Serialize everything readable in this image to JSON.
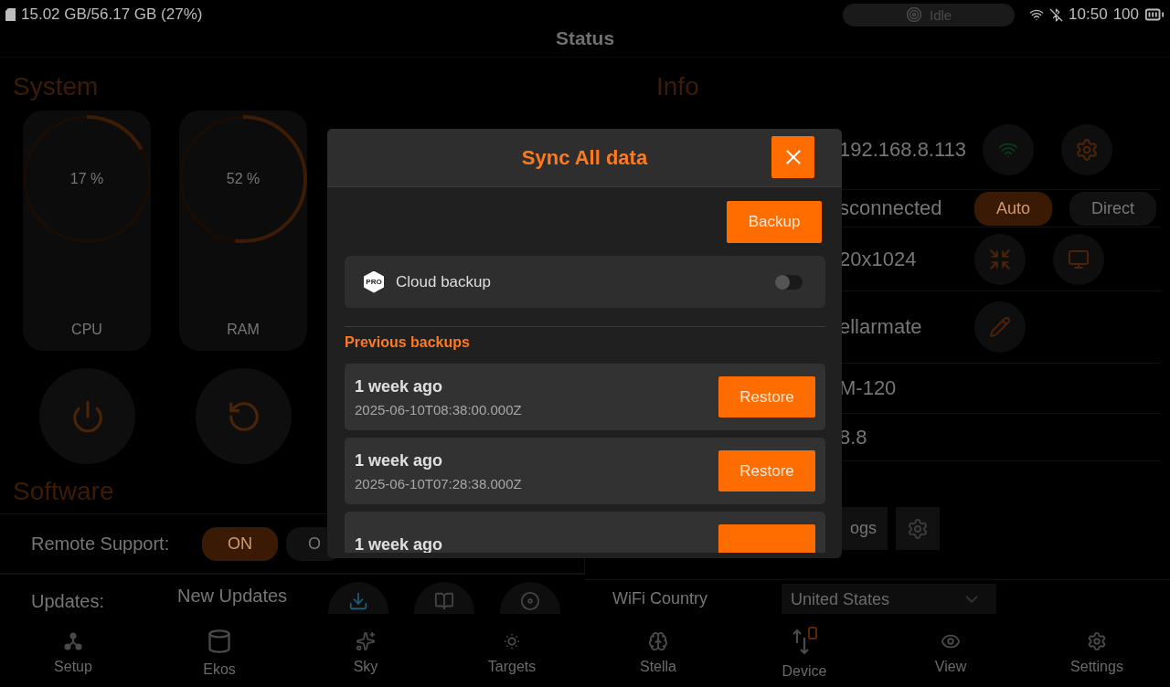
{
  "status_bar": {
    "storage": "15.02 GB/56.17 GB (27%)",
    "state": "Idle",
    "time": "10:50",
    "battery": "100"
  },
  "page_title": "Status",
  "system": {
    "heading": "System",
    "gauges": [
      {
        "label": "CPU",
        "reading": "17 %",
        "level": 0.17
      },
      {
        "label": "RAM",
        "reading": "52 %",
        "level": 0.52
      }
    ]
  },
  "software": {
    "heading": "Software",
    "remote_support": {
      "label": "Remote Support:",
      "options": [
        {
          "label": "ON",
          "selected": true
        },
        {
          "label": "O",
          "selected": false
        }
      ]
    },
    "updates": {
      "label": "Updates:",
      "title": "New Updates"
    }
  },
  "info": {
    "heading": "Info",
    "rows": [
      {
        "value": "192.168.8.113",
        "controls": [
          {
            "kind": "wifi"
          },
          {
            "kind": "gear"
          }
        ]
      },
      {
        "value": "sconnected",
        "controls": [
          {
            "kind": "pill",
            "label": "Auto",
            "selected": true
          },
          {
            "kind": "pill",
            "label": "Direct",
            "selected": false
          }
        ]
      },
      {
        "value": "20x1024",
        "controls": [
          {
            "kind": "fit"
          },
          {
            "kind": "monitor"
          }
        ]
      },
      {
        "value": "ellarmate",
        "controls": [
          {
            "kind": "edit"
          }
        ]
      },
      {
        "value": "M-120",
        "controls": []
      },
      {
        "value": "8.8",
        "controls": []
      }
    ],
    "logs_button": "ogs",
    "wifi_country": {
      "label": "WiFi Country",
      "value": "United States"
    }
  },
  "nav": [
    {
      "label": "Setup",
      "kind": "setup"
    },
    {
      "label": "Ekos",
      "kind": "ekos"
    },
    {
      "label": "Sky",
      "kind": "sky"
    },
    {
      "label": "Targets",
      "kind": "targets"
    },
    {
      "label": "Stella",
      "kind": "stella"
    },
    {
      "label": "Device",
      "kind": "device"
    },
    {
      "label": "View",
      "kind": "view"
    },
    {
      "label": "Settings",
      "kind": "settings"
    }
  ],
  "modal": {
    "title": "Sync All data",
    "backup_button": "Backup",
    "cloud_backup": {
      "badge": "PRO",
      "label": "Cloud backup",
      "on": false
    },
    "section": "Previous backups",
    "backups": [
      {
        "when": "1 week ago",
        "timestamp": "2025-06-10T08:38:00.000Z",
        "button": "Restore"
      },
      {
        "when": "1 week ago",
        "timestamp": "2025-06-10T07:28:38.000Z",
        "button": "Restore"
      },
      {
        "when": "1 week ago"
      }
    ]
  }
}
